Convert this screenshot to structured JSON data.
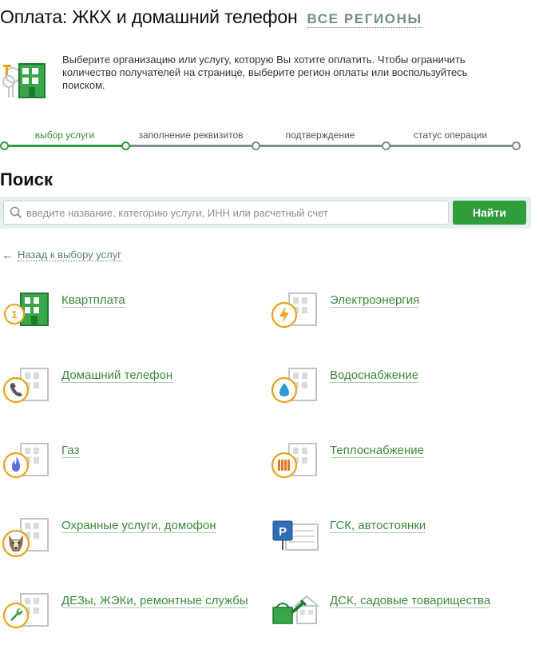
{
  "header": {
    "title": "Оплата: ЖКХ и домашний телефон",
    "region_link": "ВСЕ РЕГИОНЫ"
  },
  "intro": {
    "icon": "building-tree-icon",
    "text": "Выберите организацию или услугу, которую Вы хотите оплатить. Чтобы ограничить количество получателей на странице, выберите регион оплаты или воспользуйтесь поиском."
  },
  "steps": [
    {
      "label": "выбор услуги",
      "active": true
    },
    {
      "label": "заполнение реквизитов",
      "active": false
    },
    {
      "label": "подтверждение",
      "active": false
    },
    {
      "label": "статус операции",
      "active": false
    }
  ],
  "search": {
    "heading": "Поиск",
    "placeholder": "введите название, категорию услуги, ИНН или расчетный счет",
    "value": "",
    "button_label": "Найти"
  },
  "back_link": {
    "arrow": "←",
    "label": "Назад к выбору услуг"
  },
  "colors": {
    "accent_green": "#2f9e3b",
    "badge_orange": "#e8a21a",
    "link_green": "#3b8a3b",
    "muted_teal": "#6f8d8a"
  },
  "services": [
    {
      "label": "Квартплата",
      "icon": "apartment-rent-icon",
      "badge": "1"
    },
    {
      "label": "Электроэнергия",
      "icon": "electricity-icon"
    },
    {
      "label": "Домашний телефон",
      "icon": "home-phone-icon"
    },
    {
      "label": "Водоснабжение",
      "icon": "water-supply-icon"
    },
    {
      "label": "Газ",
      "icon": "gas-icon"
    },
    {
      "label": "Теплоснабжение",
      "icon": "heating-icon"
    },
    {
      "label": "Охранные услуги, домофон",
      "icon": "security-dog-icon"
    },
    {
      "label": "ГСК, автостоянки",
      "icon": "parking-icon",
      "badge": "P"
    },
    {
      "label": "ДЕЗы, ЖЭКи, ремонтные службы",
      "icon": "repair-wrench-icon"
    },
    {
      "label": "ДСК, садовые товарищества",
      "icon": "garden-watering-can-icon"
    }
  ]
}
